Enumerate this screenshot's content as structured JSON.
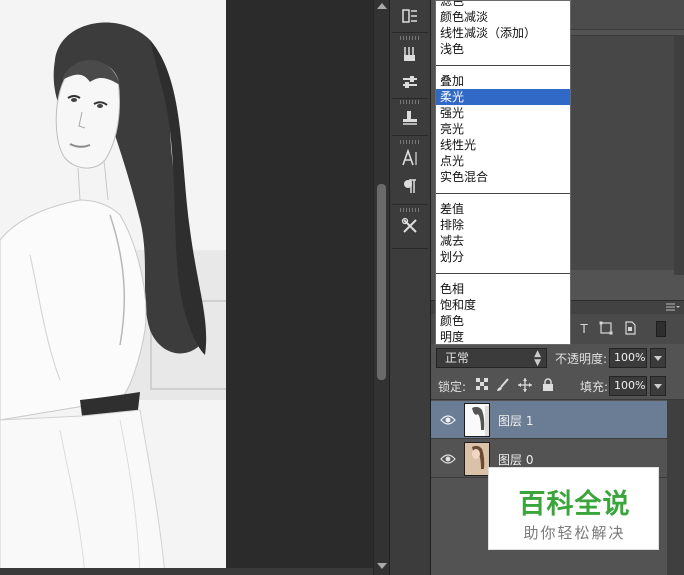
{
  "blend_mode_menu": {
    "groups": [
      [
        "滤色",
        "颜色减淡",
        "线性减淡（添加）",
        "浅色"
      ],
      [
        "叠加",
        "柔光",
        "强光",
        "亮光",
        "线性光",
        "点光",
        "实色混合"
      ],
      [
        "差值",
        "排除",
        "减去",
        "划分"
      ],
      [
        "色相",
        "饱和度",
        "颜色",
        "明度"
      ]
    ],
    "highlighted": "柔光"
  },
  "layers_panel": {
    "blend_mode_value": "正常",
    "opacity_label": "不透明度:",
    "opacity_value": "100%",
    "lock_label": "锁定:",
    "fill_label": "填充:",
    "fill_value": "100%",
    "layers": [
      {
        "name": "图层 1",
        "selected": true
      },
      {
        "name": "图层 0",
        "selected": false
      }
    ]
  },
  "tool_strip": {
    "icons": [
      "history-brush-icon",
      "brush-presets-icon",
      "tool-presets-icon",
      "clone-source-icon",
      "character-icon",
      "paragraph-icon",
      "tools-icon"
    ]
  },
  "colors": {
    "selected_layer": "#6b7d94",
    "menu_highlight": "#3169c6",
    "panel_bg": "#535353",
    "watermark_green": "#3aa53a"
  },
  "watermark": {
    "title": "百科全说",
    "subtitle": "助你轻松解决"
  }
}
